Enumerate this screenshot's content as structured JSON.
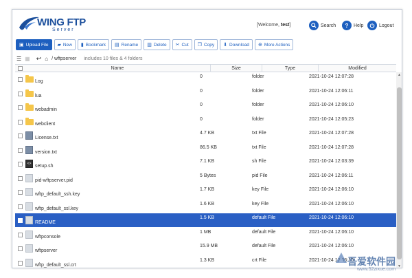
{
  "header": {
    "logo_text": "WING FTP",
    "logo_sub": "Server",
    "welcome_prefix": "[Welcome, ",
    "welcome_user": "test",
    "welcome_suffix": "]",
    "search_label": "Search",
    "help_label": "Help",
    "logout_label": "Logout"
  },
  "toolbar": {
    "upload": "Upload File",
    "new": "New",
    "bookmark": "Bookmark",
    "rename": "Rename",
    "delete": "Delete",
    "cut": "Cut",
    "copy": "Copy",
    "download": "Download",
    "more": "More Actions"
  },
  "path": {
    "location": "/ wftpserver",
    "summary": "includes 10 files & 4 folders"
  },
  "columns": {
    "name": "Name",
    "size": "Size",
    "type": "Type",
    "modified": "Modified"
  },
  "files": [
    {
      "name": "Log",
      "size": "0",
      "type": "folder",
      "modified": "2021-10-24 12:07:28",
      "icon": "folder-icon"
    },
    {
      "name": "lua",
      "size": "0",
      "type": "folder",
      "modified": "2021-10-24 12:06:11",
      "icon": "folder-icon"
    },
    {
      "name": "webadmin",
      "size": "0",
      "type": "folder",
      "modified": "2021-10-24 12:06:10",
      "icon": "folder-icon"
    },
    {
      "name": "webclient",
      "size": "0",
      "type": "folder",
      "modified": "2021-10-24 12:05:23",
      "icon": "folder-icon"
    },
    {
      "name": "License.txt",
      "size": "4.7 KB",
      "type": "txt File",
      "modified": "2021-10-24 12:07:28",
      "icon": "text-file-icon"
    },
    {
      "name": "version.txt",
      "size": "86.5 KB",
      "type": "txt File",
      "modified": "2021-10-24 12:07:28",
      "icon": "text-file-icon"
    },
    {
      "name": "setup.sh",
      "size": "7.1 KB",
      "type": "sh File",
      "modified": "2021-10-24 12:03:39",
      "icon": "script-file-icon"
    },
    {
      "name": "pid-wftpserver.pid",
      "size": "5 Bytes",
      "type": "pid File",
      "modified": "2021-10-24 12:06:11",
      "icon": "file-icon"
    },
    {
      "name": "wftp_default_ssh.key",
      "size": "1.7 KB",
      "type": "key File",
      "modified": "2021-10-24 12:06:10",
      "icon": "file-icon"
    },
    {
      "name": "wftp_default_ssl.key",
      "size": "1.6 KB",
      "type": "key File",
      "modified": "2021-10-24 12:06:10",
      "icon": "file-icon"
    },
    {
      "name": "README",
      "size": "1.5 KB",
      "type": "default File",
      "modified": "2021-10-24 12:06:10",
      "icon": "file-icon"
    },
    {
      "name": "wftpconsole",
      "size": "1 MB",
      "type": "default File",
      "modified": "2021-10-24 12:06:10",
      "icon": "file-icon"
    },
    {
      "name": "wftpserver",
      "size": "15.9 MB",
      "type": "default File",
      "modified": "2021-10-24 12:06:10",
      "icon": "file-icon"
    },
    {
      "name": "wftp_default_ssl.crt",
      "size": "1.3 KB",
      "type": "crt File",
      "modified": "2021-10-24 12:06:10",
      "icon": "file-icon"
    }
  ],
  "selected_index": 10,
  "watermark": {
    "main": "吾爱软件园",
    "sub": "www.52zixue.com"
  },
  "colors": {
    "accent": "#1d5fbf",
    "selected_row": "#2a5fc4",
    "folder": "#f5c64a"
  }
}
